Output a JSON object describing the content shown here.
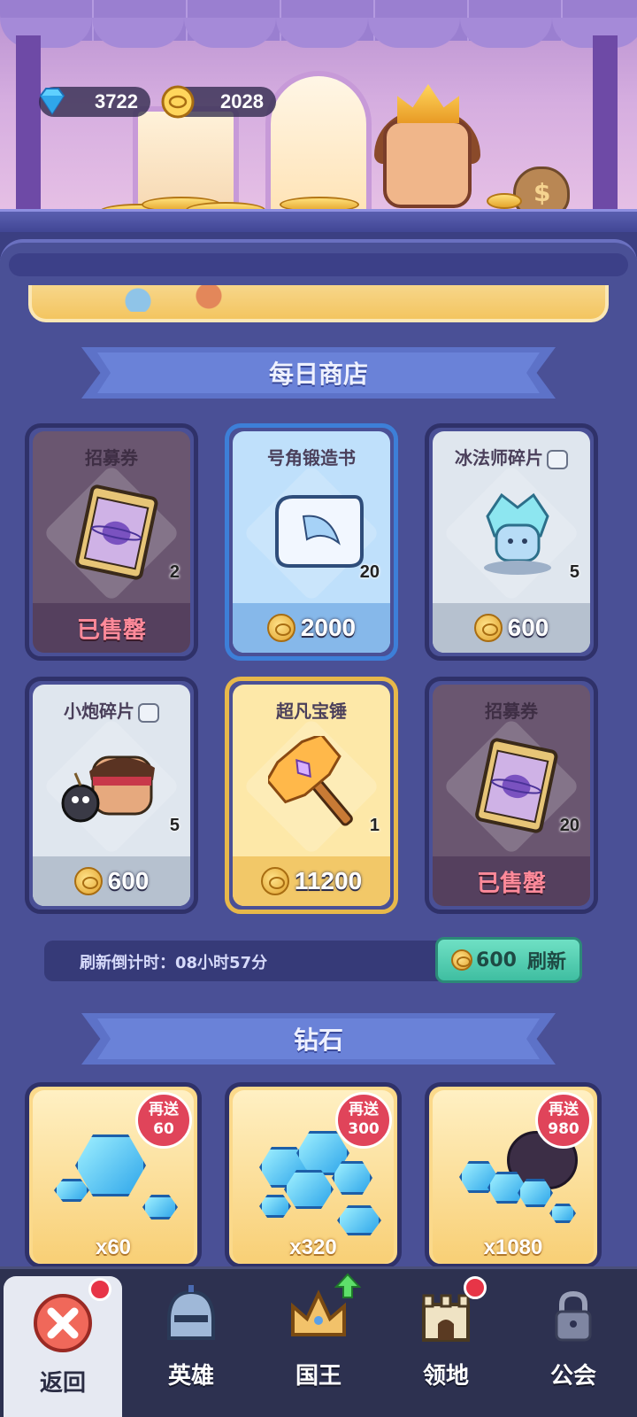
{
  "currency": {
    "diamonds": "3722",
    "coins": "2028"
  },
  "sections": {
    "daily_shop": "每日商店",
    "diamonds": "钻石"
  },
  "shop_items": [
    {
      "name": "招募券",
      "count": "2",
      "price": "",
      "status": "已售罄"
    },
    {
      "name": "号角锻造书",
      "count": "20",
      "price": "2000",
      "status": ""
    },
    {
      "name": "冰法师碎片",
      "count": "5",
      "price": "600",
      "status": ""
    },
    {
      "name": "小炮碎片",
      "count": "5",
      "price": "600",
      "status": ""
    },
    {
      "name": "超凡宝锤",
      "count": "1",
      "price": "11200",
      "status": ""
    },
    {
      "name": "招募券",
      "count": "20",
      "price": "",
      "status": "已售罄"
    }
  ],
  "refresh": {
    "countdown": "刷新倒计时：08小时57分",
    "cost": "600",
    "button_label": "刷新"
  },
  "diamond_packs": [
    {
      "amount": "x60",
      "bonus_label": "再送",
      "bonus": "60"
    },
    {
      "amount": "x320",
      "bonus_label": "再送",
      "bonus": "300"
    },
    {
      "amount": "x1080",
      "bonus_label": "再送",
      "bonus": "980"
    }
  ],
  "nav": {
    "back": "返回",
    "heroes": "英雄",
    "king": "国王",
    "territory": "领地",
    "guild": "公会"
  },
  "colors": {
    "panel": "#4a5096",
    "sold_text": "#ff8a9a",
    "refresh_button": "#3fbea1",
    "badge": "#e0445a"
  }
}
